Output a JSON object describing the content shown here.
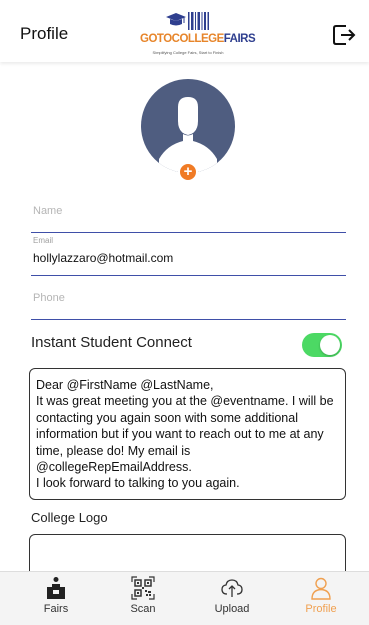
{
  "header": {
    "title": "Profile",
    "logo_brand_a": "GOTOCOLLEGE",
    "logo_brand_b": "FAIRS",
    "logo_tagline": "Simplifying College Fairs, Start to Finish",
    "logout_icon": "logout-icon"
  },
  "profile": {
    "add_photo_icon": "plus-icon",
    "name_placeholder": "Name",
    "email_label": "Email",
    "email_value": "hollylazzaro@hotmail.com",
    "phone_placeholder": "Phone"
  },
  "instant_connect": {
    "label": "Instant Student Connect",
    "enabled": true,
    "toggle_color": "#4cd964",
    "message": "Dear @FirstName @LastName,\nIt was great meeting you at the @eventname. I will be contacting you again soon with some additional information but if you want to reach out to me at any time, please do! My email is @collegeRepEmailAddress.\nI look forward to talking to you again."
  },
  "college_logo": {
    "label": "College Logo"
  },
  "tabs": [
    {
      "label": "Fairs",
      "icon": "desk-icon",
      "active": false
    },
    {
      "label": "Scan",
      "icon": "qr-code-icon",
      "active": false
    },
    {
      "label": "Upload",
      "icon": "cloud-upload-icon",
      "active": false
    },
    {
      "label": "Profile",
      "icon": "user-icon",
      "active": true
    }
  ],
  "colors": {
    "accent_orange": "#f07b25",
    "field_underline": "#3f4fa8",
    "avatar_bg": "#4f5d80",
    "active_tab": "#f0a050"
  }
}
